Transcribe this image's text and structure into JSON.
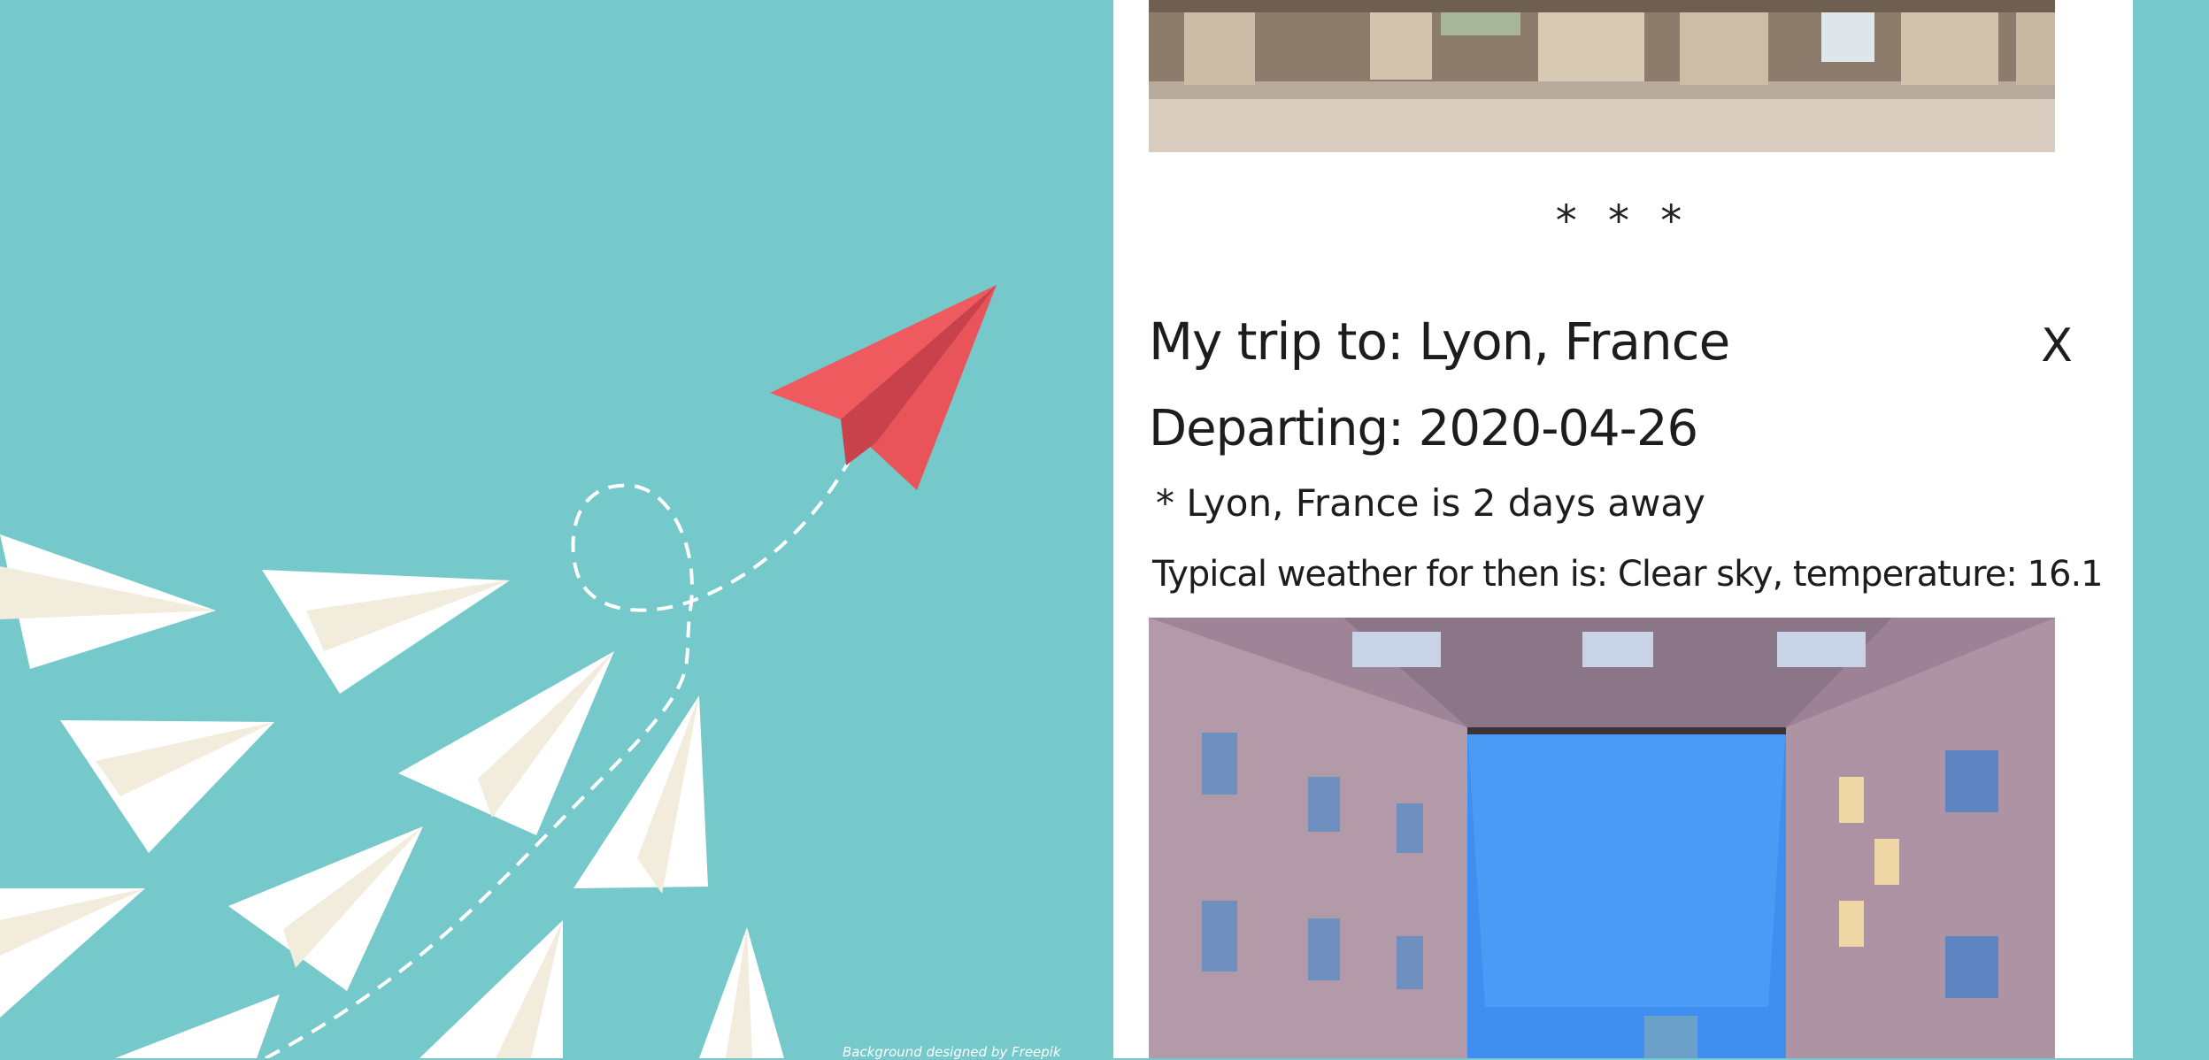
{
  "hero": {
    "credit": "Background designed by Freepik",
    "colors": {
      "background": "#76c9cb",
      "lead_plane": "#ef5a5f",
      "planes": "#ffffff",
      "plane_shade": "#f1ecdc"
    },
    "icons": [
      "red-paper-plane",
      "white-paper-plane",
      "dashed-flight-path"
    ]
  },
  "trip": {
    "separator": "* * *",
    "title": "My trip to: Lyon, France",
    "remove_label": "X",
    "departing": "Departing: 2020-04-26",
    "days_away": "* Lyon, France is 2 days away",
    "weather": "Typical weather for then is: Clear sky, temperature: 16.1"
  }
}
